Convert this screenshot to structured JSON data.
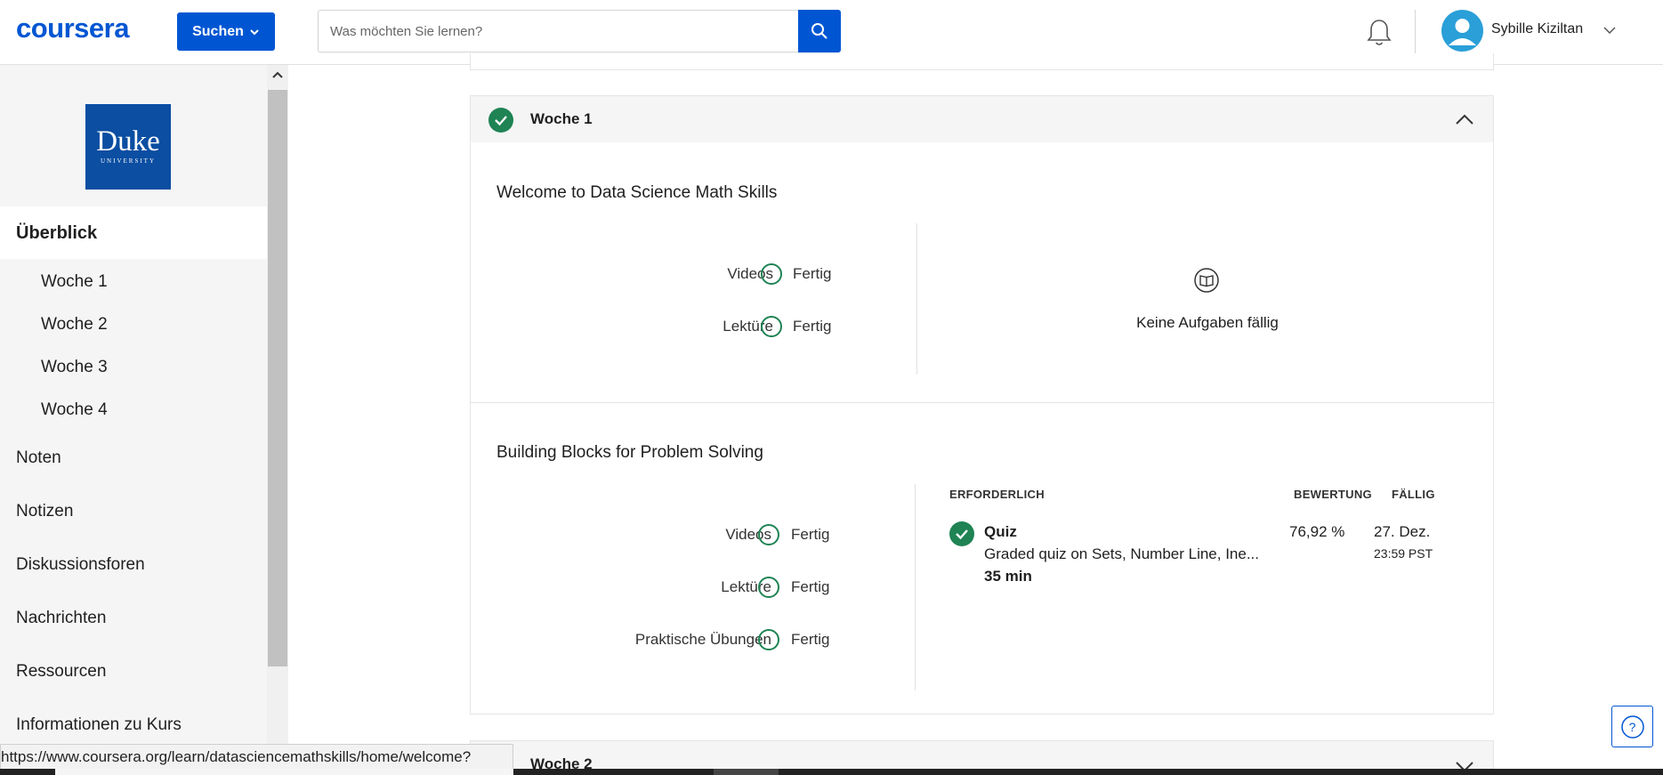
{
  "header": {
    "logo": "coursera",
    "explore_label": "Suchen",
    "search_placeholder": "Was möchten Sie lernen?",
    "user_name": "Sybille Kiziltan"
  },
  "sidebar": {
    "logo_word": "Duke",
    "logo_sub": "UNIVERSITY",
    "overview": "Überblick",
    "weeks": [
      "Woche 1",
      "Woche 2",
      "Woche 3",
      "Woche 4"
    ],
    "items": [
      "Noten",
      "Notizen",
      "Diskussionsforen",
      "Nachrichten",
      "Ressourcen",
      "Informationen zu Kurs"
    ]
  },
  "week1": {
    "title": "Woche 1",
    "section1": {
      "title": "Welcome to Data Science Math Skills",
      "rows": [
        {
          "label": "Videos",
          "status": "Fertig"
        },
        {
          "label": "Lektüre",
          "status": "Fertig"
        }
      ],
      "no_assignments": "Keine Aufgaben fällig"
    },
    "section2": {
      "title": "Building Blocks for Problem Solving",
      "rows": [
        {
          "label": "Videos",
          "status": "Fertig"
        },
        {
          "label": "Lektüre",
          "status": "Fertig"
        },
        {
          "label": "Praktische Übungen",
          "status": "Fertig"
        }
      ],
      "headers": {
        "required": "ERFORDERLICH",
        "grade": "BEWERTUNG",
        "due": "FÄLLIG"
      },
      "quiz": {
        "type": "Quiz",
        "name": "Graded quiz on Sets, Number Line, Ine...",
        "duration": "35 min",
        "grade": "76,92 %",
        "due_date": "27. Dez.",
        "due_time": "23:59 PST"
      }
    }
  },
  "week2": {
    "title": "Woche 2"
  },
  "status_url": "https://www.coursera.org/learn/datasciencemathskills/home/welcome?",
  "help_label": "?"
}
